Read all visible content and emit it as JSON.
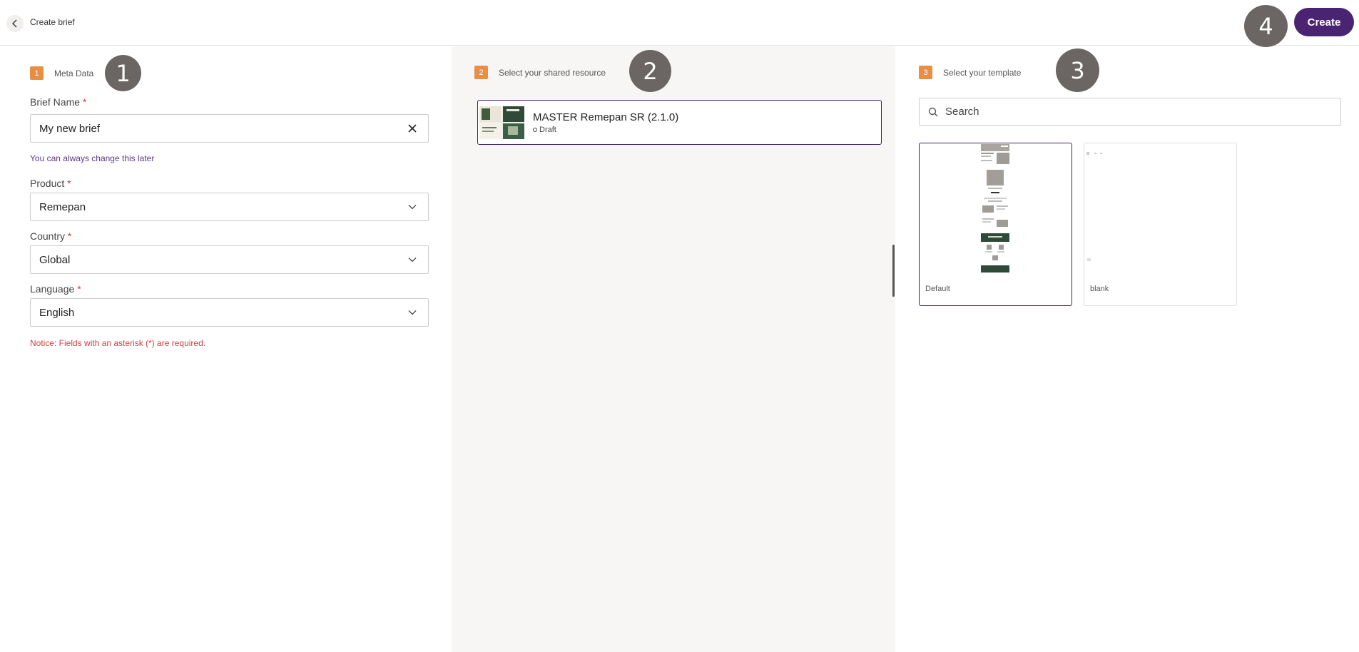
{
  "header": {
    "title": "Create brief",
    "create_label": "Create"
  },
  "callouts": [
    "1",
    "2",
    "3",
    "4"
  ],
  "steps": [
    {
      "number": "1",
      "label": "Meta Data"
    },
    {
      "number": "2",
      "label": "Select your shared resource"
    },
    {
      "number": "3",
      "label": "Select your template"
    }
  ],
  "form": {
    "brief_name": {
      "label": "Brief Name",
      "required": "*",
      "value": "My new brief",
      "hint": "You can always change this later"
    },
    "product": {
      "label": "Product",
      "required": "*",
      "value": "Remepan"
    },
    "country": {
      "label": "Country",
      "required": "*",
      "value": "Global"
    },
    "language": {
      "label": "Language",
      "required": "*",
      "value": "English"
    },
    "notice": "Notice: Fields with an asterisk (*) are required."
  },
  "resource": {
    "title": "MASTER Remepan SR (2.1.0)",
    "status": "Draft"
  },
  "search": {
    "placeholder": "Search"
  },
  "templates": [
    {
      "name": "Default",
      "selected": true
    },
    {
      "name": "blank",
      "selected": false
    }
  ],
  "colors": {
    "accent": "#4a2473",
    "step_badge": "#e88e45",
    "required": "#d04040",
    "callout": "#6b6663"
  }
}
